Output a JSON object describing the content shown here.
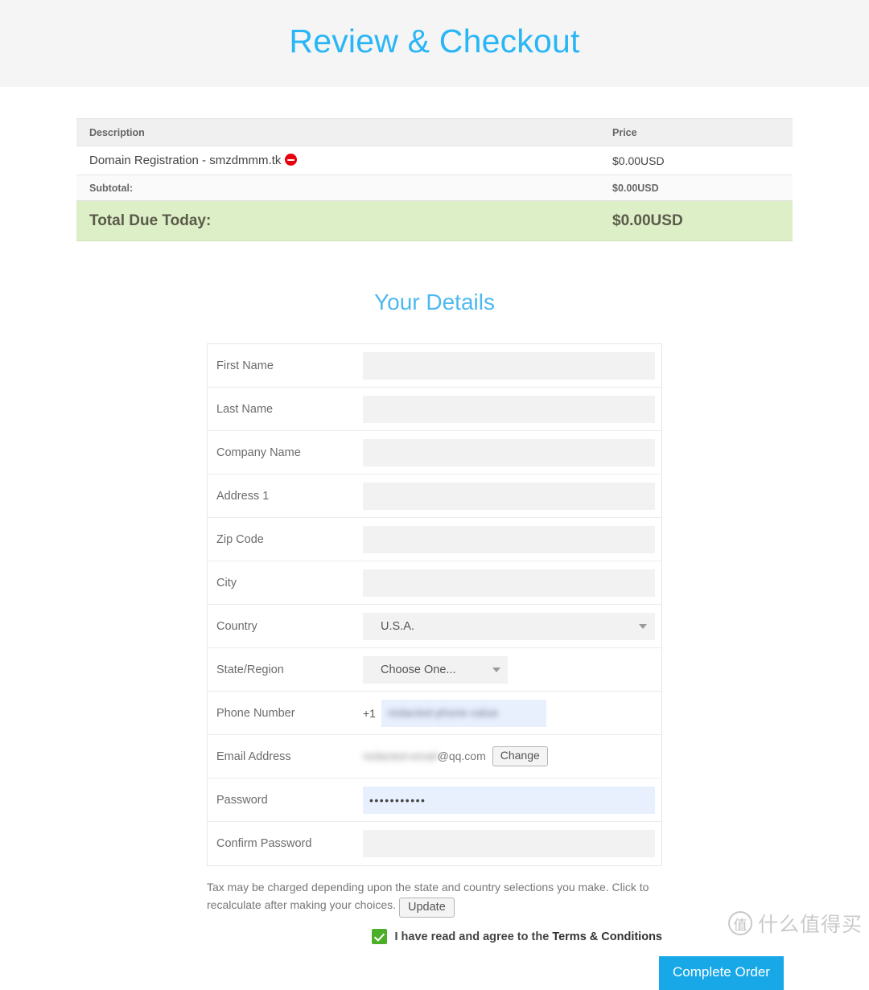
{
  "header": {
    "title": "Review & Checkout",
    "background": "#f5f5f5",
    "title_color": "#29b6f6"
  },
  "order_summary": {
    "columns": {
      "description": "Description",
      "price": "Price"
    },
    "items": [
      {
        "description": "Domain Registration - smzdmmm.tk",
        "price": "$0.00USD",
        "remove_icon": "remove-circle-icon"
      }
    ],
    "subtotal": {
      "label": "Subtotal:",
      "value": "$0.00USD"
    },
    "total": {
      "label": "Total Due Today:",
      "value": "$0.00USD",
      "background": "#ddefc6"
    }
  },
  "details": {
    "title": "Your Details",
    "title_color": "#4db9ef",
    "fields": [
      {
        "label": "First Name",
        "value": "",
        "type": "text"
      },
      {
        "label": "Last Name",
        "value": "",
        "type": "text"
      },
      {
        "label": "Company Name",
        "value": "",
        "type": "text"
      },
      {
        "label": "Address 1",
        "value": "",
        "type": "text"
      },
      {
        "label": "Zip Code",
        "value": "",
        "type": "text"
      },
      {
        "label": "City",
        "value": "",
        "type": "text"
      }
    ],
    "country": {
      "label": "Country",
      "value": "U.S.A.",
      "caret_icon": "chevron-down-icon"
    },
    "state": {
      "label": "State/Region",
      "value": "Choose One...",
      "caret_icon": "chevron-down-icon"
    },
    "phone": {
      "label": "Phone Number",
      "prefix": "+1",
      "value": "redacted-phone-value"
    },
    "email": {
      "label": "Email Address",
      "masked_local": "redacted-email",
      "domain": "@qq.com",
      "change_label": "Change"
    },
    "password": {
      "label": "Password",
      "value": "•••••••••••"
    },
    "confirm_password": {
      "label": "Confirm Password",
      "value": ""
    }
  },
  "footer": {
    "tax_note": "Tax may be charged depending upon the state and country selections you make. Click to recalculate after making your choices.",
    "update_label": "Update",
    "agree_prefix": "I have read and agree to the ",
    "agree_terms": "Terms & Conditions",
    "checkbox_checked": true,
    "checkbox_color": "#4caf28",
    "complete_label": "Complete Order",
    "complete_color": "#18a8e8"
  },
  "watermark": {
    "logo_char": "值",
    "text": "什么值得买"
  }
}
